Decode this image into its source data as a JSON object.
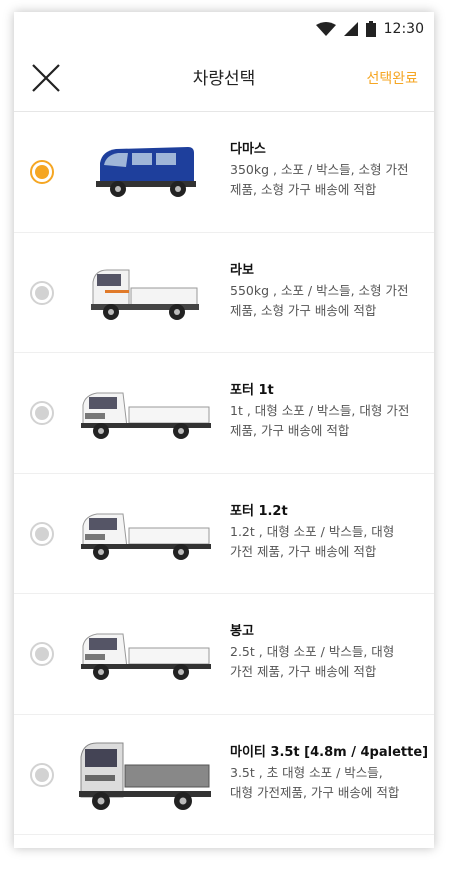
{
  "status": {
    "time": "12:30"
  },
  "header": {
    "title": "차량선택",
    "done_label": "선택완료"
  },
  "colors": {
    "accent": "#f5a623",
    "radio_off": "#d2d2d2"
  },
  "vehicles": [
    {
      "name": "다마스",
      "line1": "350kg , 소포 / 박스들, 소형 가전",
      "line2": "제품, 소형 가구 배송에 적합",
      "selected": true,
      "icon": "van-icon"
    },
    {
      "name": "라보",
      "line1": "550kg , 소포 / 박스들, 소형 가전",
      "line2": "제품, 소형 가구 배송에 적합",
      "selected": false,
      "icon": "mini-truck-icon"
    },
    {
      "name": "포터 1t",
      "line1": "1t , 대형 소포 / 박스들, 대형 가전",
      "line2": "제품, 가구 배송에 적합",
      "selected": false,
      "icon": "truck-icon"
    },
    {
      "name": "포터 1.2t",
      "line1": "1.2t , 대형 소포 / 박스들, 대형",
      "line2": "가전 제품, 가구 배송에 적합",
      "selected": false,
      "icon": "truck-icon"
    },
    {
      "name": "봉고",
      "line1": "2.5t , 대형 소포 / 박스들, 대형",
      "line2": "가전 제품, 가구 배송에 적합",
      "selected": false,
      "icon": "truck-icon"
    },
    {
      "name": "마이티 3.5t [4.8m / 4palette]",
      "line1": "3.5t , 초 대형 소포 / 박스들,",
      "line2": "대형 가전제품, 가구 배송에 적합",
      "selected": false,
      "icon": "large-truck-icon"
    }
  ]
}
